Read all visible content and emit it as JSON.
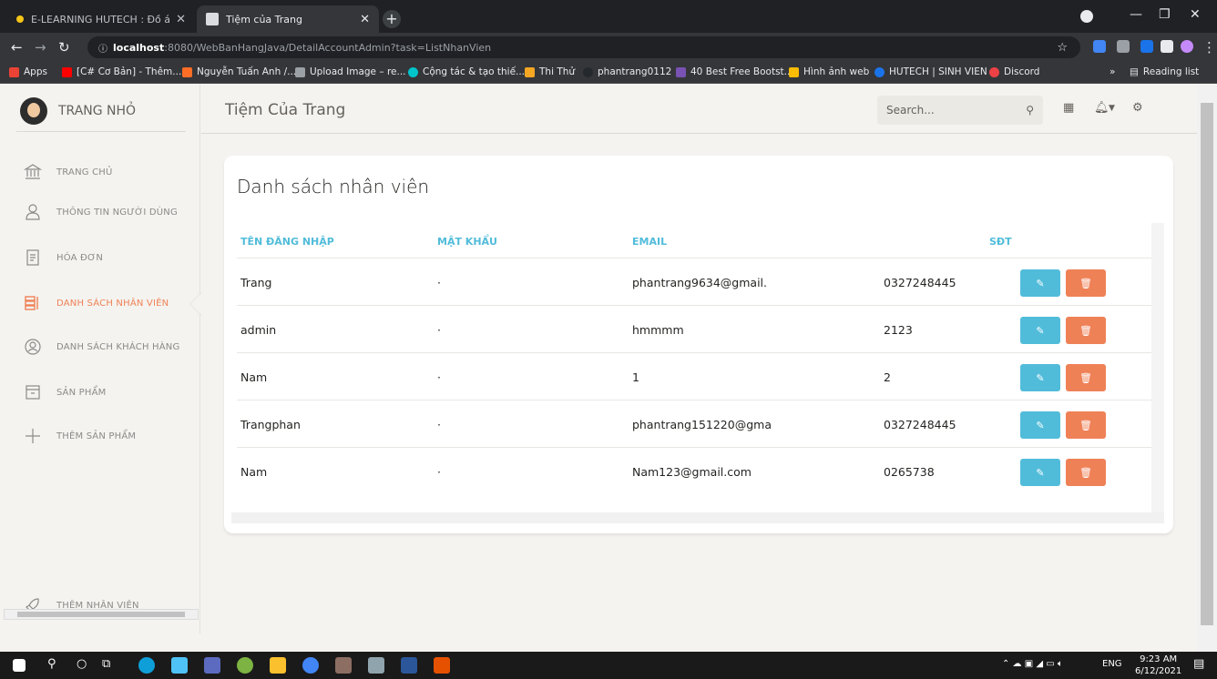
{
  "browser": {
    "tabs": [
      {
        "title": "E-LEARNING HUTECH : Đồ án java",
        "active": false
      },
      {
        "title": "Tiệm của Trang",
        "active": true
      }
    ],
    "address": {
      "host": "localhost",
      "path": ":8080/WebBanHangJava/DetailAccountAdmin?task=ListNhanVien"
    },
    "bookmarks": [
      {
        "label": "Apps",
        "color": "#ea4335"
      },
      {
        "label": "[C# Cơ Bản] - Thêm...",
        "color": "#ff0000"
      },
      {
        "label": "Nguyễn Tuấn Anh /...",
        "color": "#fc6d26"
      },
      {
        "label": "Upload Image – re...",
        "color": "#9aa0a6"
      },
      {
        "label": "Cộng tác & tạo thiế...",
        "color": "#00c4cc"
      },
      {
        "label": "Thi Thử",
        "color": "#f5a623"
      },
      {
        "label": "phantrang0112",
        "color": "#24292e"
      },
      {
        "label": "40 Best Free Bootst...",
        "color": "#7952b3"
      },
      {
        "label": "Hình ảnh web",
        "color": "#fbbc04"
      },
      {
        "label": "HUTECH | SINH VIEN",
        "color": "#1a73e8"
      },
      {
        "label": "Discord",
        "color": "#ed4245"
      }
    ],
    "reading_list": "Reading list",
    "more": "»"
  },
  "sidebar": {
    "brand": "TRANG NHỎ",
    "items": [
      {
        "label": "TRANG CHỦ",
        "icon": "bank-icon",
        "active": false
      },
      {
        "label": "THÔNG TIN NGƯỜI DÙNG",
        "icon": "user-icon",
        "active": false
      },
      {
        "label": "HÓA ĐƠN",
        "icon": "receipt-icon",
        "active": false
      },
      {
        "label": "DANH SÁCH NHÂN VIÊN",
        "icon": "list-icon",
        "active": true
      },
      {
        "label": "DANH SÁCH KHÁCH HÀNG",
        "icon": "user-circle-icon",
        "active": false
      },
      {
        "label": "SẢN PHẨM",
        "icon": "box-icon",
        "active": false
      },
      {
        "label": "THÊM SẢN PHẨM",
        "icon": "plus-icon",
        "active": false
      }
    ],
    "bottom_item": {
      "label": "THÊM NHÂN VIÊN",
      "icon": "spaceship-icon"
    }
  },
  "navbar": {
    "title": "Tiệm Của Trang",
    "search_placeholder": "Search..."
  },
  "card": {
    "title": "Danh sách nhân viên",
    "columns": [
      "TÊN ĐĂNG NHẬP",
      "MẬT KHẨU",
      "EMAIL",
      "SĐT"
    ],
    "rows": [
      {
        "username": "Trang",
        "password": "·",
        "email": "phantrang9634@gmail.",
        "phone": "0327248445"
      },
      {
        "username": "admin",
        "password": "·",
        "email": "hmmmm",
        "phone": "2123"
      },
      {
        "username": "Nam",
        "password": "·",
        "email": "1",
        "phone": "2"
      },
      {
        "username": "Trangphan",
        "password": "·",
        "email": "phantrang151220@gma",
        "phone": "0327248445"
      },
      {
        "username": "Nam",
        "password": "·",
        "email": "Nam123@gmail.com",
        "phone": "0265738"
      }
    ]
  },
  "taskbar": {
    "lang": "ENG",
    "time": "9:23 AM",
    "date": "6/12/2021"
  },
  "colors": {
    "accent": "#ef8157",
    "info": "#51bcda",
    "sidebar_bg": "#f4f3ef"
  }
}
